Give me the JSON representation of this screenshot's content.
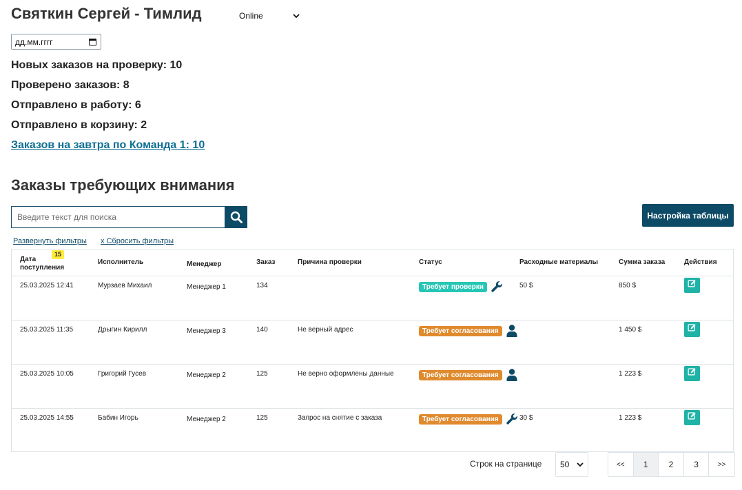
{
  "header": {
    "title": "Святкин Сергей - Тимлид",
    "status_value": "Online",
    "date_placeholder": "дд.мм.гггг"
  },
  "stats": {
    "new_orders": "Новых заказов на проверку: 10",
    "checked": "Проверено заказов: 8",
    "to_work": "Отправлено в работу: 6",
    "to_trash": "Отправлено в корзину: 2",
    "tomorrow_link": "Заказов на завтра по Команда 1: 10"
  },
  "section_title": "Заказы требующих внимания",
  "search": {
    "placeholder": "Введите текст для поиска"
  },
  "table_config_label": "Настройка таблицы",
  "filters": {
    "expand": "Развернуть фильтры",
    "reset": "x Сбросить фильтры"
  },
  "table": {
    "count_badge": "15",
    "headers": {
      "date": "Дата поступления",
      "executor": "Исполнитель",
      "manager": "Менеджер",
      "order": "Заказ",
      "reason": "Причина проверки",
      "status": "Статус",
      "materials": "Расходные материалы",
      "sum": "Сумма заказа",
      "actions": "Действия"
    },
    "rows": [
      {
        "date": "25.03.2025 12:41",
        "executor": "Мурзаев Михаил",
        "manager": "Менеджер 1",
        "order": "134",
        "reason": "",
        "status": "Требует проверки",
        "status_color": "#26c6b5",
        "status_icon": "wrench-icon",
        "materials": "50 $",
        "sum": "850 $"
      },
      {
        "date": "25.03.2025 11:35",
        "executor": "Дрыгин Кирилл",
        "manager": "Менеджер 3",
        "order": "140",
        "reason": "Не верный адрес",
        "status": "Требует согласования",
        "status_color": "#e08a2e",
        "status_icon": "user-icon",
        "materials": "",
        "sum": "1 450 $"
      },
      {
        "date": "25.03.2025 10:05",
        "executor": "Григорий Гусев",
        "manager": "Менеджер 2",
        "order": "125",
        "reason": "Не верно оформлены данные",
        "status": "Требует согласования",
        "status_color": "#e08a2e",
        "status_icon": "user-icon",
        "materials": "",
        "sum": "1 223 $"
      },
      {
        "date": "25.03.2025 14:55",
        "executor": "Бабин Игорь",
        "manager": "Менеджер 2",
        "order": "125",
        "reason": "Запрос на снятие с заказа",
        "status": "Требует согласования",
        "status_color": "#e08a2e",
        "status_icon": "wrench-icon",
        "materials": "30 $",
        "sum": "1 223 $"
      }
    ]
  },
  "pagination": {
    "rows_label": "Строк на странице",
    "rows_value": "50",
    "first": "<<",
    "pages": [
      "1",
      "2",
      "3"
    ],
    "last": ">>"
  },
  "colors": {
    "primary": "#0d4a66",
    "teal": "#1fb2a6",
    "link": "#0e6f94"
  }
}
